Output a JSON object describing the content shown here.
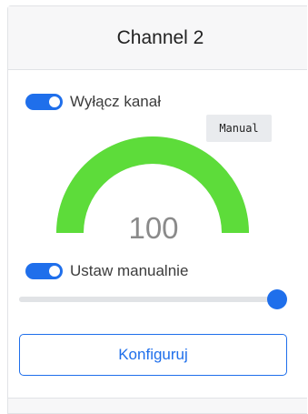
{
  "card": {
    "title": "Channel 2"
  },
  "toggles": {
    "disable_channel": {
      "label": "Wyłącz kanał",
      "on": true
    },
    "manual": {
      "label": "Ustaw manualnie",
      "on": true
    }
  },
  "gauge": {
    "mode_badge": "Manual",
    "value": "100",
    "level": 1.0
  },
  "slider": {
    "level": 1.0
  },
  "buttons": {
    "configure_label": "Konfiguruj"
  },
  "colors": {
    "accent": "#1f6feb",
    "gauge_fill": "#5ddc3a",
    "track": "#e1e3e6",
    "value_text": "#8a8a8a"
  }
}
